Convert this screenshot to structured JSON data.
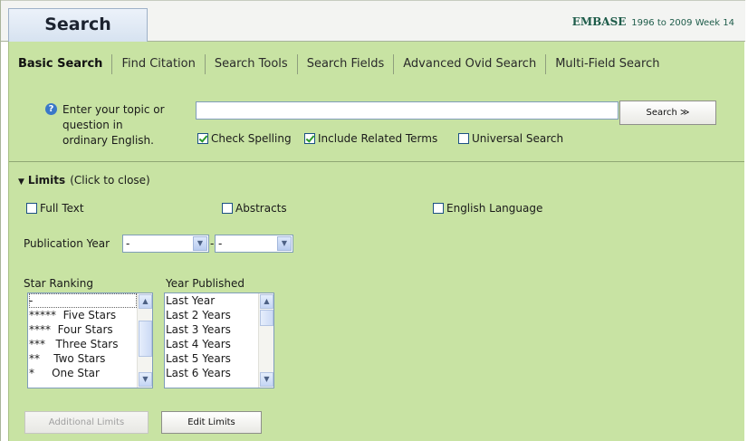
{
  "header": {
    "title": "Search",
    "database_name": "EMBASE",
    "database_range": "1996 to 2009 Week 14"
  },
  "tabs": [
    {
      "label": "Basic Search"
    },
    {
      "label": "Find Citation"
    },
    {
      "label": "Search Tools"
    },
    {
      "label": "Search Fields"
    },
    {
      "label": "Advanced Ovid Search"
    },
    {
      "label": "Multi-Field Search"
    }
  ],
  "search": {
    "prompt_line1": "Enter your topic or",
    "prompt_line2": "question in",
    "prompt_line3": "ordinary English.",
    "value": "",
    "button_label": "Search ≫",
    "options": [
      {
        "label": "Check Spelling",
        "checked": true
      },
      {
        "label": "Include Related Terms",
        "checked": true
      },
      {
        "label": "Universal Search",
        "checked": false
      }
    ]
  },
  "limits": {
    "heading": "Limits",
    "hint": "(Click to close)",
    "checkboxes": [
      {
        "label": "Full Text",
        "checked": false
      },
      {
        "label": "Abstracts",
        "checked": false
      },
      {
        "label": "English Language",
        "checked": false
      }
    ],
    "publication_year": {
      "label": "Publication Year",
      "from_value": "-",
      "separator": "-",
      "to_value": "-"
    },
    "star_ranking": {
      "label": "Star Ranking",
      "options": [
        "-",
        "*****  Five Stars",
        "****  Four Stars",
        "***   Three Stars",
        "**    Two Stars",
        "*     One Star"
      ]
    },
    "year_published": {
      "label": "Year Published",
      "options": [
        "Last Year",
        "Last 2 Years",
        "Last 3 Years",
        "Last 4 Years",
        "Last 5 Years",
        "Last 6 Years"
      ]
    },
    "additional_limits_label": "Additional Limits",
    "edit_limits_label": "Edit Limits"
  },
  "colors": {
    "panel_bg": "#c8e3a3",
    "header_bg": "#f3f4f2",
    "db_text": "#1e5c4a",
    "checkbox_border": "#1c5183"
  }
}
